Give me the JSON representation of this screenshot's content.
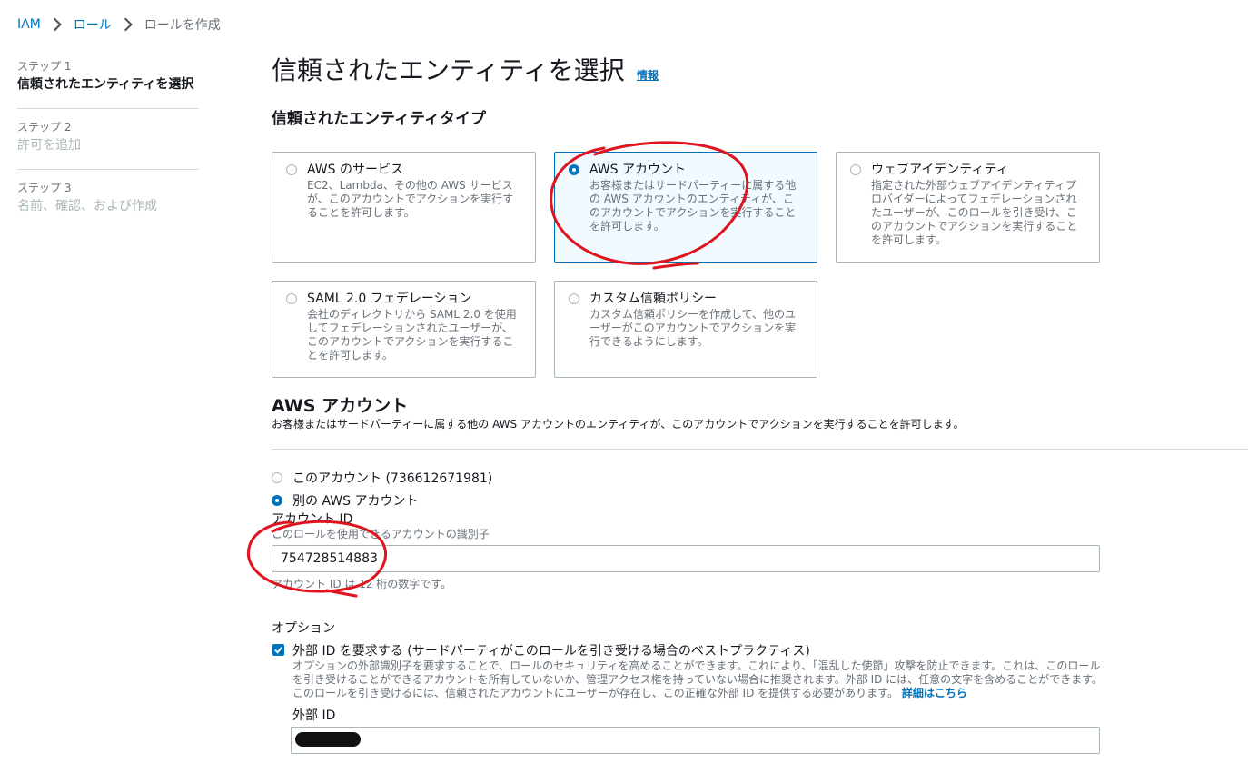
{
  "breadcrumb": {
    "items": [
      "IAM",
      "ロール"
    ],
    "current": "ロールを作成"
  },
  "steps": [
    {
      "num": "ステップ 1",
      "title": "信頼されたエンティティを選択"
    },
    {
      "num": "ステップ 2",
      "title": "許可を追加"
    },
    {
      "num": "ステップ 3",
      "title": "名前、確認、および作成"
    }
  ],
  "page": {
    "title": "信頼されたエンティティを選択",
    "info_link": "情報"
  },
  "entity_type": {
    "heading": "信頼されたエンティティタイプ",
    "selected": "aws-account",
    "tiles": [
      {
        "title": "AWS のサービス",
        "desc": "EC2、Lambda、その他の AWS サービスが、このアカウントでアクションを実行することを許可します。"
      },
      {
        "title": "AWS アカウント",
        "desc": "お客様またはサードパーティーに属する他の AWS アカウントのエンティティが、このアカウントでアクションを実行することを許可します。"
      },
      {
        "title": "ウェブアイデンティティ",
        "desc": "指定された外部ウェブアイデンティティプロバイダーによってフェデレーションされたユーザーが、このロールを引き受け、このアカウントでアクションを実行することを許可します。"
      },
      {
        "title": "SAML 2.0 フェデレーション",
        "desc": "会社のディレクトリから SAML 2.0 を使用してフェデレーションされたユーザーが、このアカウントでアクションを実行することを許可します。"
      },
      {
        "title": "カスタム信頼ポリシー",
        "desc": "カスタム信頼ポリシーを作成して、他のユーザーがこのアカウントでアクションを実行できるようにします。"
      }
    ]
  },
  "aws_account": {
    "heading": "AWS アカウント",
    "description": "お客様またはサードパーティーに属する他の AWS アカウントのエンティティが、このアカウントでアクションを実行することを許可します。",
    "option_this": "このアカウント (736612671981)",
    "option_other": "別の AWS アカウント",
    "account_id_label": "アカウント ID",
    "account_id_hint": "このロールを使用できるアカウントの識別子",
    "account_id_value": "754728514883",
    "account_id_constraint": "アカウント ID は 12 桁の数字です。"
  },
  "options": {
    "heading": "オプション",
    "require_external_id_label": "外部 ID を要求する (サードパーティがこのロールを引き受ける場合のベストプラクティス)",
    "require_external_id_checked": true,
    "require_external_id_desc": "オプションの外部識別子を要求することで、ロールのセキュリティを高めることができます。これにより、「混乱した使節」攻撃を防止できます。これは、このロールを引き受けることができるアカウントを所有していないか、管理アクセス権を持っていない場合に推奨されます。外部 ID には、任意の文字を含めることができます。このロールを引き受けるには、信頼されたアカウントにユーザーが存在し、この正確な外部 ID を提供する必要があります。",
    "learn_more": "詳細はこちら",
    "external_id_label": "外部 ID"
  },
  "colors": {
    "link": "#0073bb",
    "selected_bg": "#f1faff",
    "annotation": "#e0141e"
  }
}
